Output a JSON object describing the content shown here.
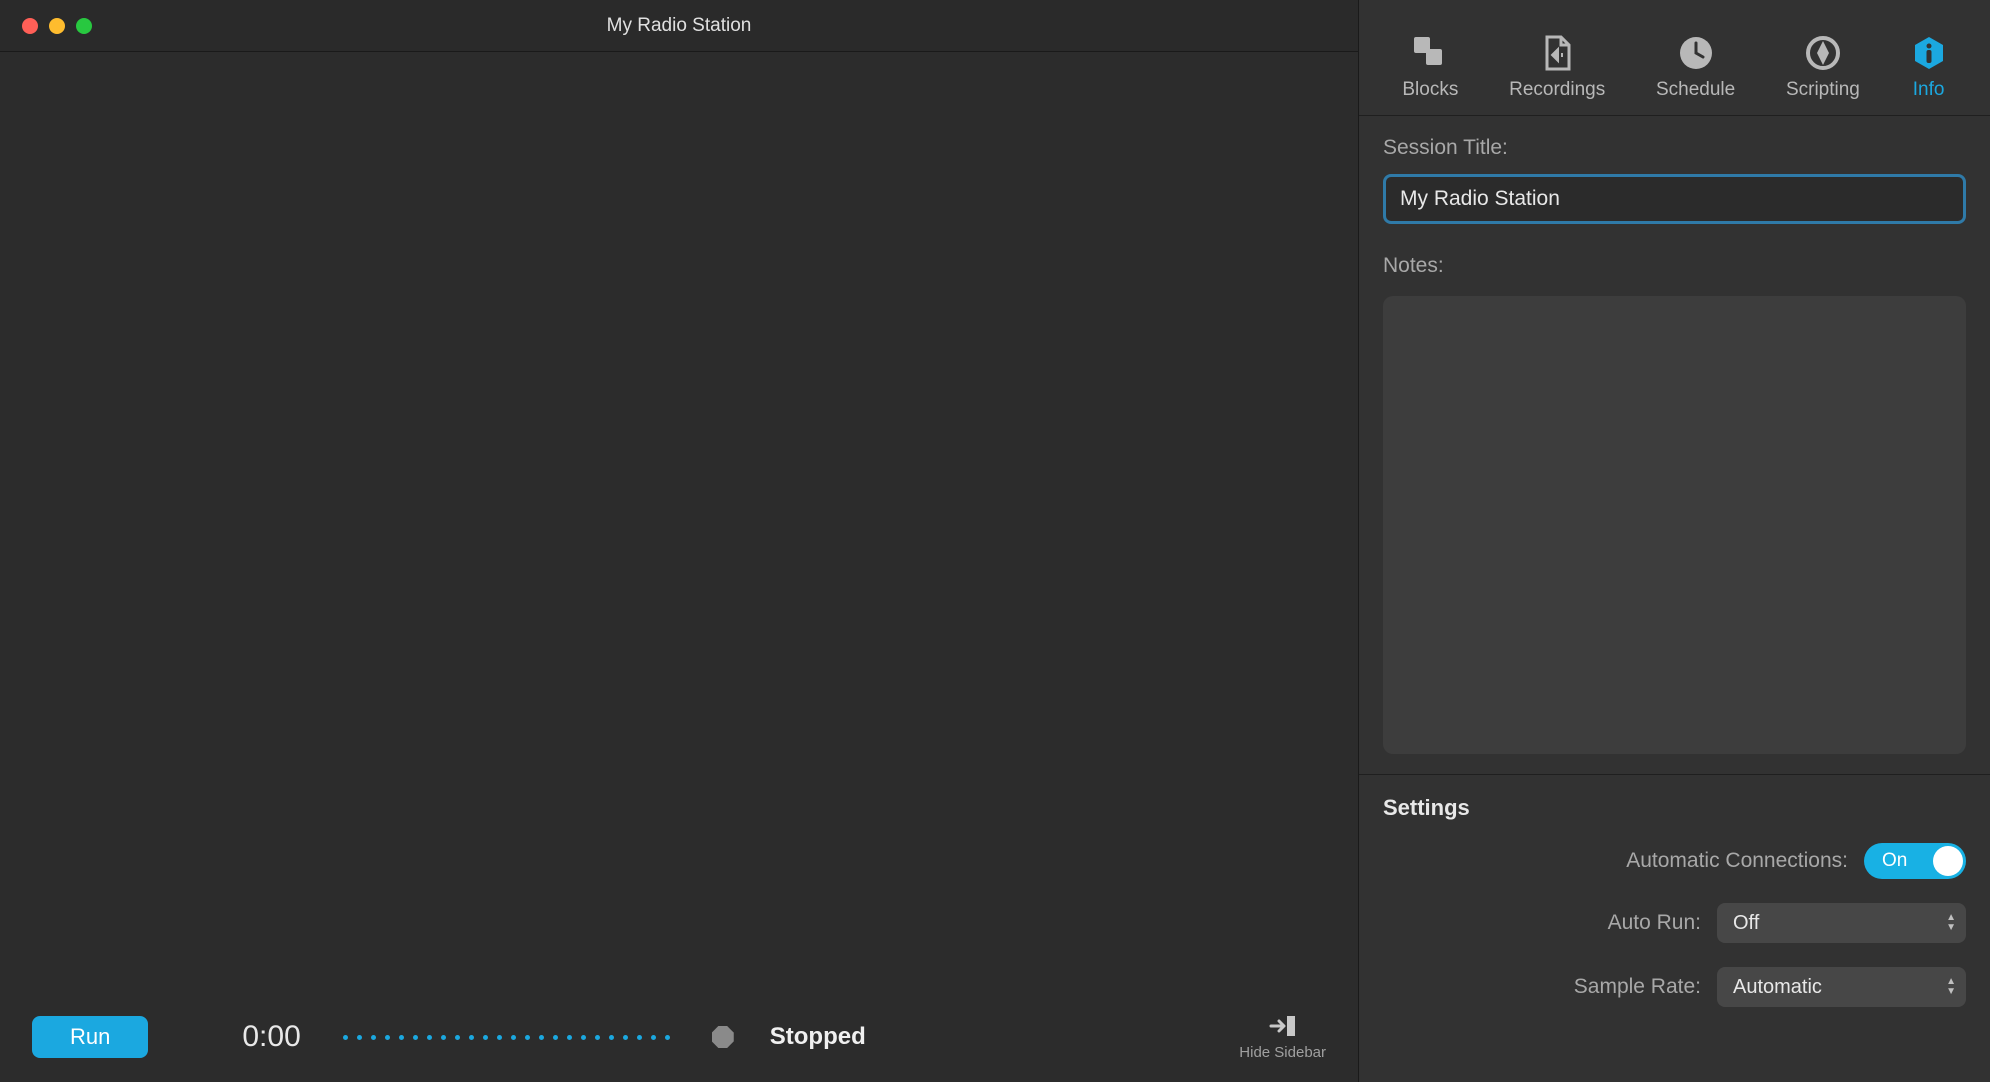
{
  "window": {
    "title": "My Radio Station"
  },
  "bottom": {
    "run_label": "Run",
    "time": "0:00",
    "status": "Stopped",
    "hide_sidebar_label": "Hide Sidebar"
  },
  "sidebar": {
    "tabs": [
      {
        "label": "Blocks"
      },
      {
        "label": "Recordings"
      },
      {
        "label": "Schedule"
      },
      {
        "label": "Scripting"
      },
      {
        "label": "Info"
      }
    ],
    "info": {
      "session_title_label": "Session Title:",
      "session_title_value": "My Radio Station",
      "notes_label": "Notes:",
      "notes_value": ""
    },
    "settings": {
      "heading": "Settings",
      "auto_connections_label": "Automatic Connections:",
      "auto_connections_value": "On",
      "auto_run_label": "Auto Run:",
      "auto_run_value": "Off",
      "sample_rate_label": "Sample Rate:",
      "sample_rate_value": "Automatic"
    }
  }
}
